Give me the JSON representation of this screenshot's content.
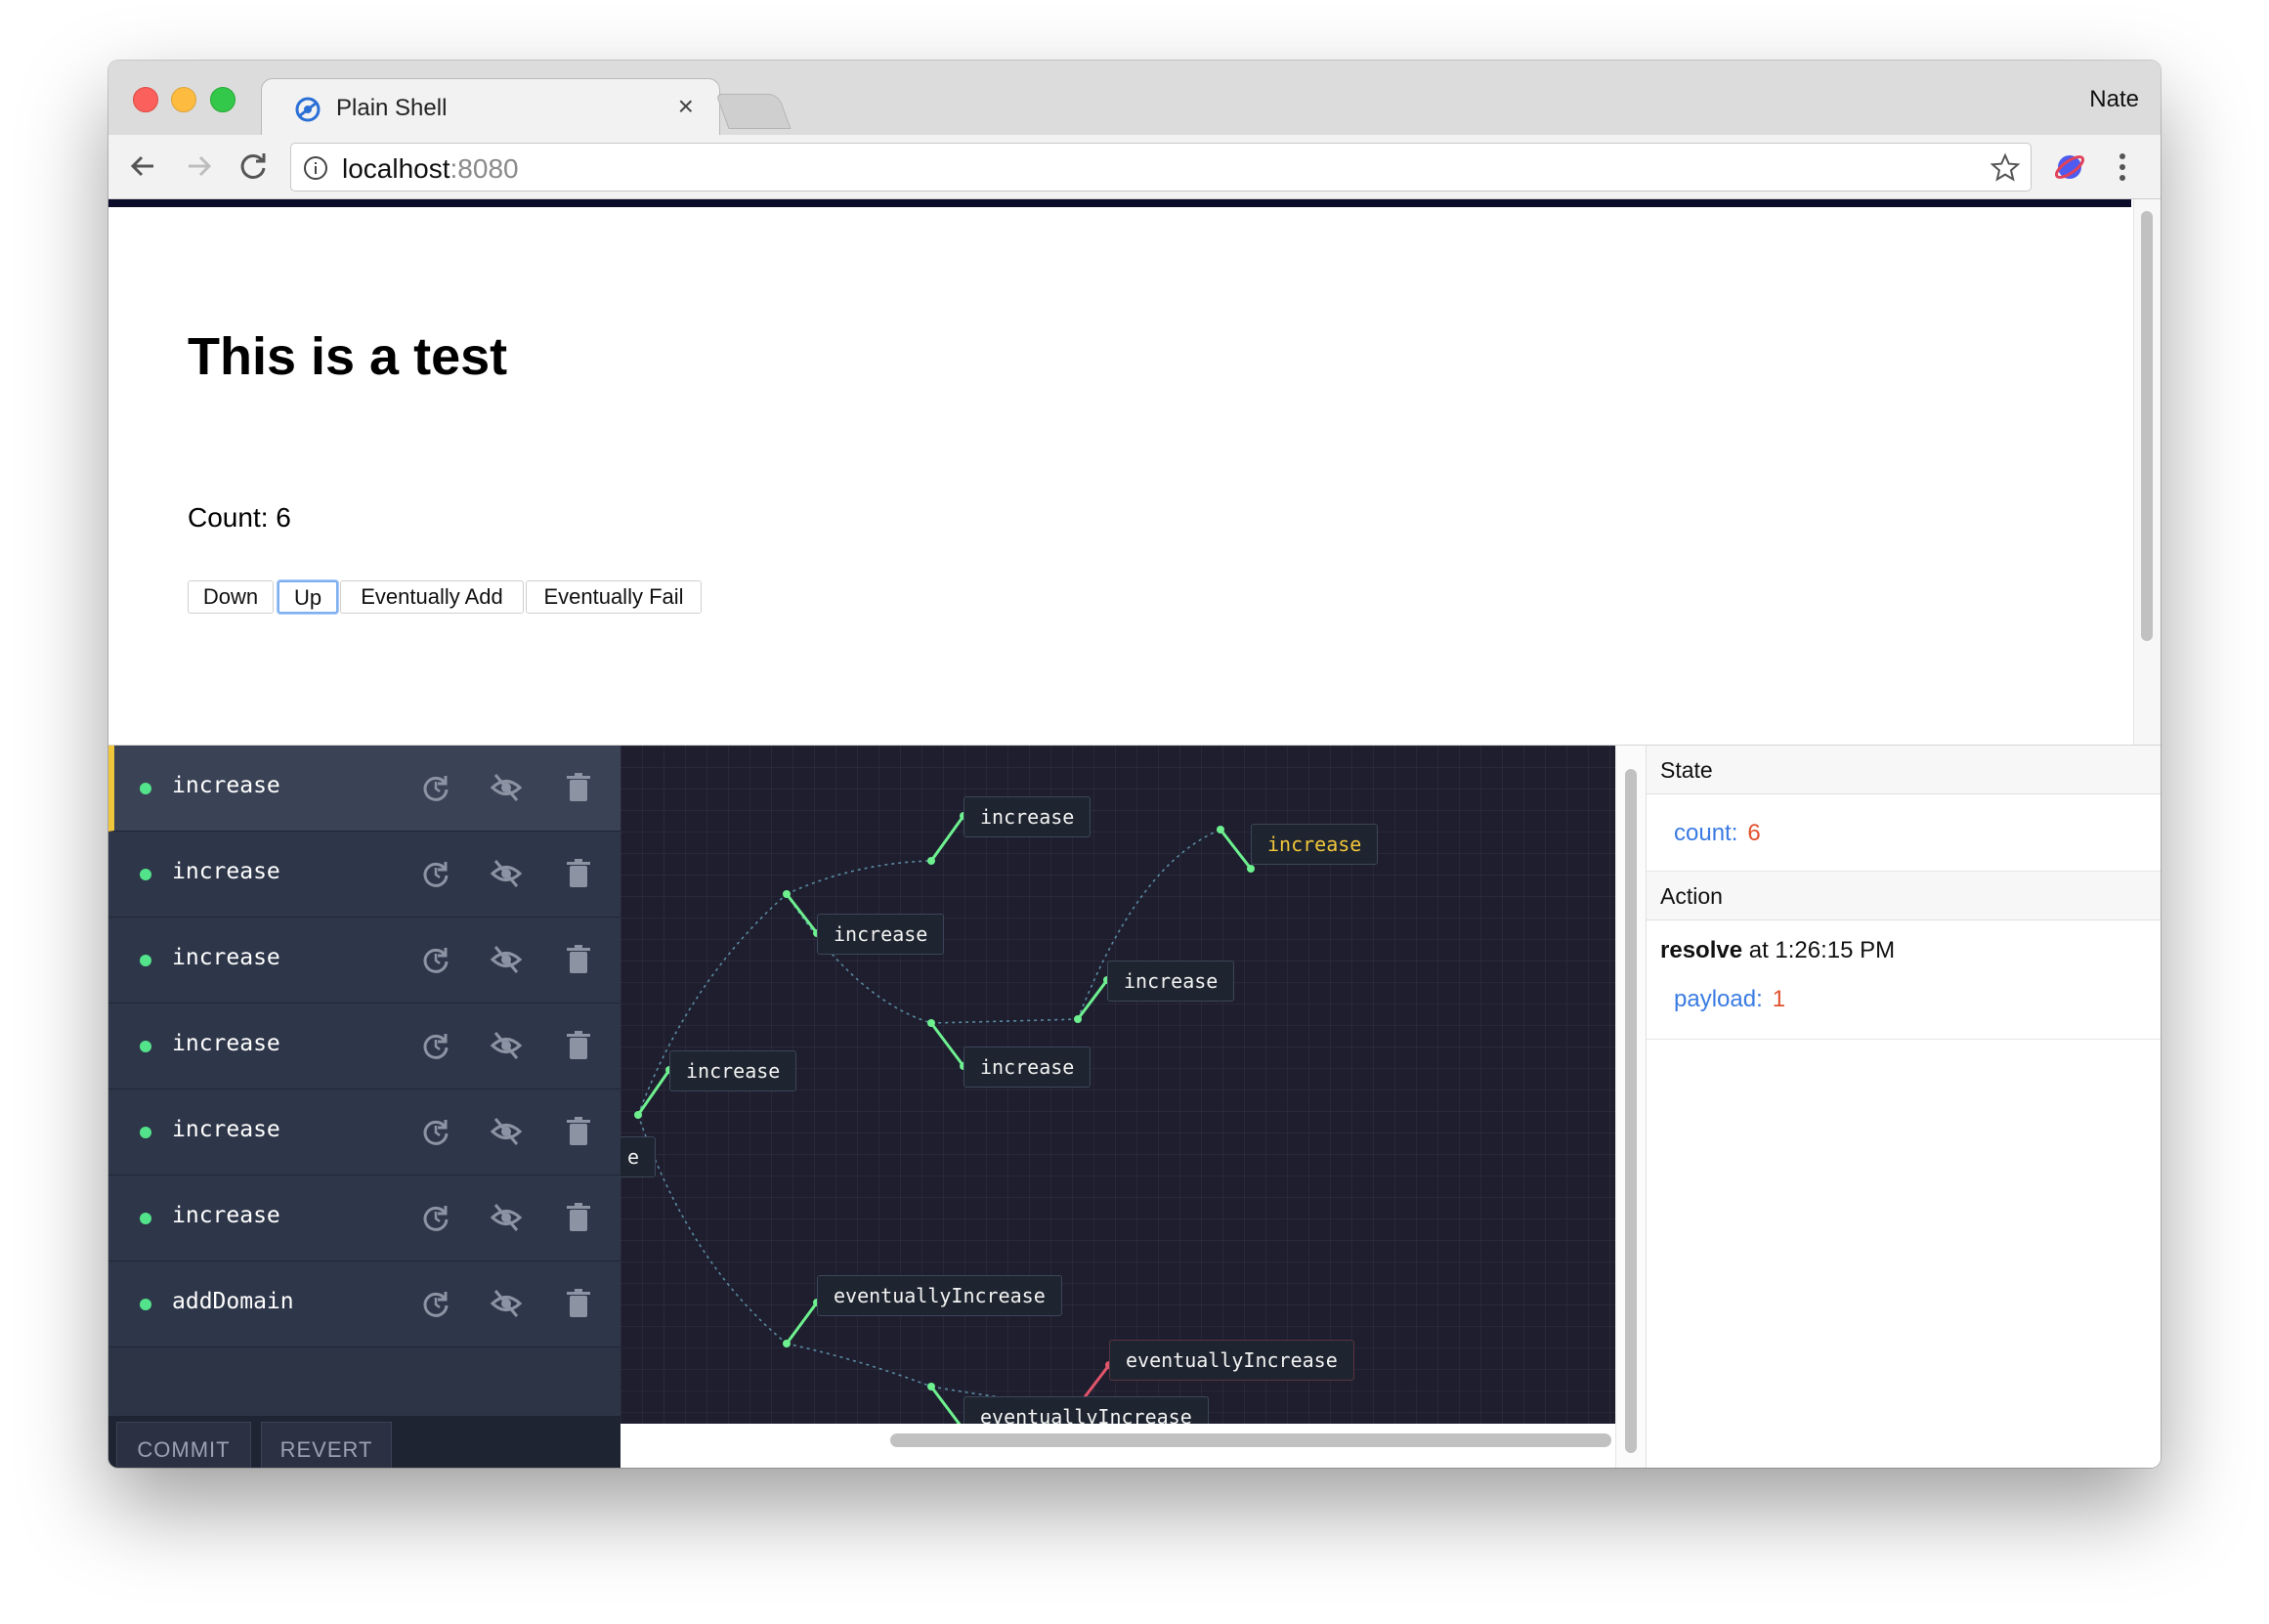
{
  "browser": {
    "tab_title": "Plain Shell",
    "tab_close": "×",
    "profile_name": "Nate",
    "url_host": "localhost",
    "url_port": ":8080"
  },
  "page": {
    "heading": "This is a test",
    "count_text": "Count: 6",
    "buttons": [
      "Down",
      "Up",
      "Eventually Add",
      "Eventually Fail"
    ]
  },
  "devtools": {
    "actions": [
      "increase",
      "increase",
      "increase",
      "increase",
      "increase",
      "increase",
      "addDomain"
    ],
    "action_icons": [
      "replay-icon",
      "hide-icon",
      "trash-icon"
    ],
    "footer": {
      "commit": "COMMIT",
      "revert": "REVERT"
    },
    "graph_nodes": [
      "increase",
      "increase",
      "increase",
      "increase",
      "increase",
      "increase",
      "e",
      "eventuallyIncrease",
      "eventuallyIncrease",
      "eventuallyIncrease"
    ],
    "inspector": {
      "state_header": "State",
      "state_key": "count:",
      "state_value": "6",
      "action_header": "Action",
      "action_type": "resolve",
      "action_time": " at 1:26:15 PM",
      "payload_key": "payload:",
      "payload_value": "1"
    }
  },
  "colors": {
    "active_marker": "#f0c63a",
    "status_dot": "#52e38b",
    "graph_bg": "#1e1e2f",
    "failed_edge": "#e2556b",
    "json_key": "#3a7be2",
    "json_value": "#e0522e"
  }
}
